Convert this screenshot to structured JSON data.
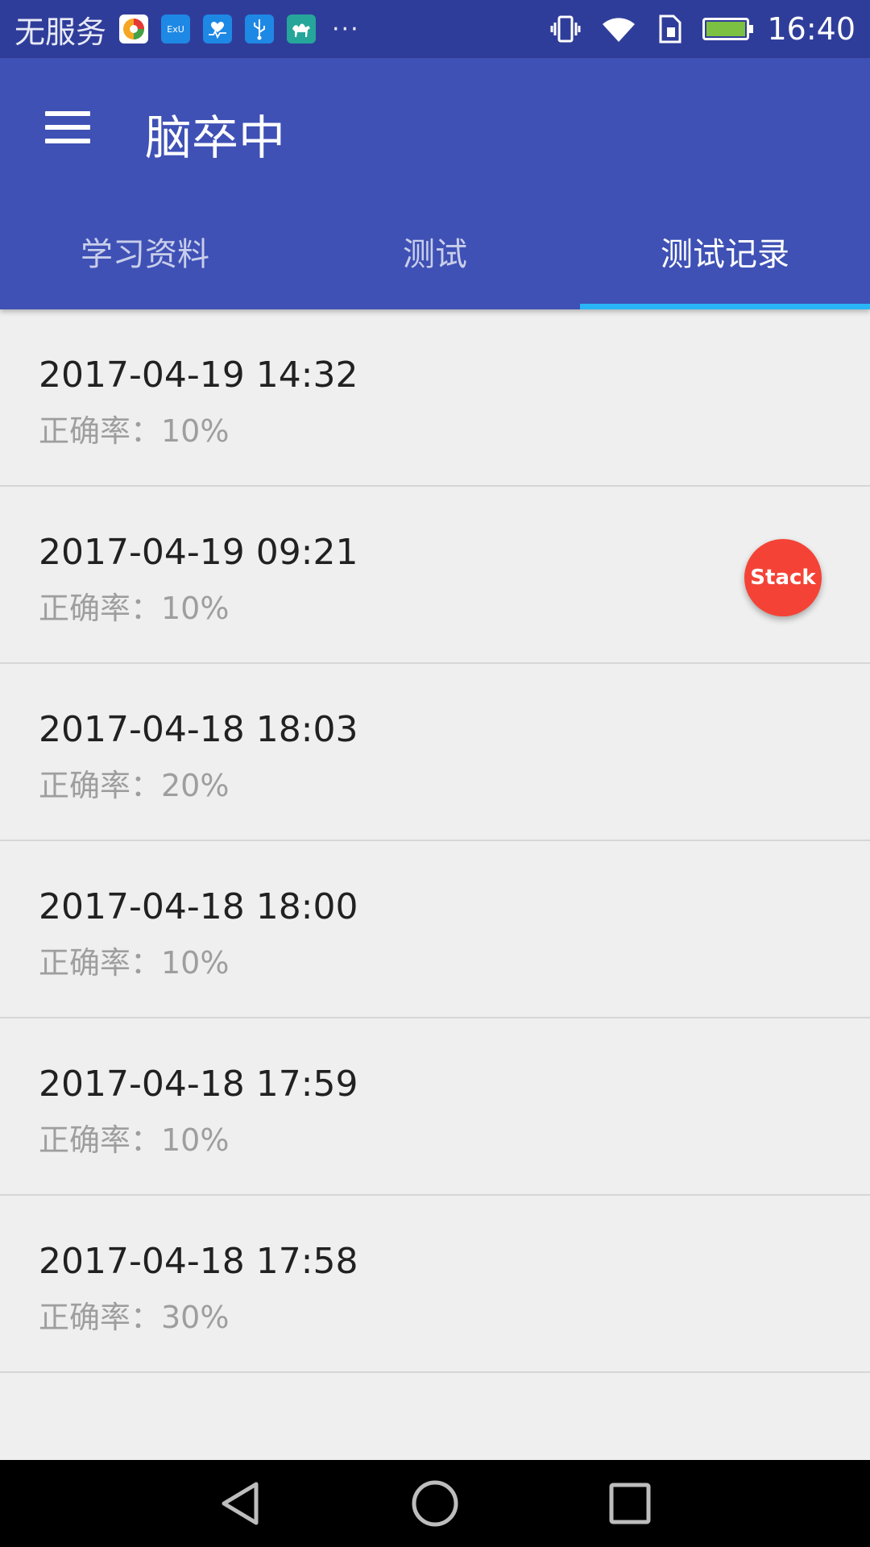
{
  "status_bar": {
    "carrier": "无服务",
    "app_icons": [
      {
        "name": "browser-app-icon",
        "color": "#f5a623"
      },
      {
        "name": "exu-app-icon",
        "color": "#1e88e5",
        "label": "ExU"
      },
      {
        "name": "health-app-icon",
        "color": "#1e88e5"
      },
      {
        "name": "usb-icon",
        "color": "#1e88e5"
      },
      {
        "name": "camel-app-icon",
        "color": "#26a69a"
      }
    ],
    "more": "···",
    "time": "16:40"
  },
  "toolbar": {
    "title": "脑卒中"
  },
  "tabs": [
    {
      "label": "学习资料",
      "active": false
    },
    {
      "label": "测试",
      "active": false
    },
    {
      "label": "测试记录",
      "active": true
    }
  ],
  "records": [
    {
      "datetime": "2017-04-19 14:32",
      "accuracy": "正确率：10%"
    },
    {
      "datetime": "2017-04-19 09:21",
      "accuracy": "正确率：10%"
    },
    {
      "datetime": "2017-04-18 18:03",
      "accuracy": "正确率：20%"
    },
    {
      "datetime": "2017-04-18 18:00",
      "accuracy": "正确率：10%"
    },
    {
      "datetime": "2017-04-18 17:59",
      "accuracy": "正确率：10%"
    },
    {
      "datetime": "2017-04-18 17:58",
      "accuracy": "正确率：30%"
    }
  ],
  "fab": {
    "label": "Stack"
  },
  "colors": {
    "primary": "#3f51b5",
    "status_bar": "#2f3d9a",
    "tab_indicator": "#29b6f6",
    "fab": "#f44336",
    "background": "#efefef"
  }
}
